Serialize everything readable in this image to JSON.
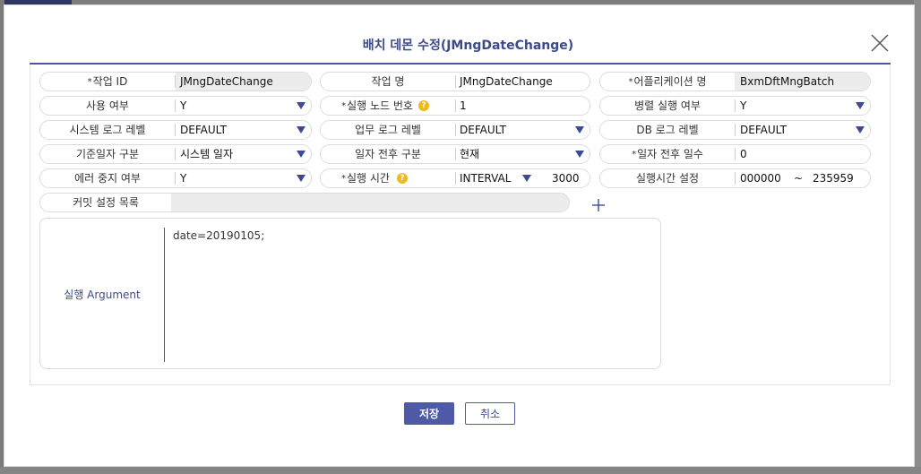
{
  "modal": {
    "title": "배치 데몬 수정(JMngDateChange)",
    "save_label": "저장",
    "cancel_label": "취소"
  },
  "fields": {
    "job_id": {
      "label": "작업 ID",
      "value": "JMngDateChange"
    },
    "job_name": {
      "label": "작업 명",
      "value": "JMngDateChange"
    },
    "app_name": {
      "label": "어플리케이션 명",
      "value": "BxmDftMngBatch"
    },
    "use_yn": {
      "label": "사용 여부",
      "value": "Y"
    },
    "exec_node": {
      "label": "실행 노드 번호",
      "value": "1"
    },
    "parallel_exec": {
      "label": "병렬 실행 여부",
      "value": "Y"
    },
    "sys_log_level": {
      "label": "시스템 로그 레벨",
      "value": "DEFAULT"
    },
    "biz_log_level": {
      "label": "업무 로그 레벨",
      "value": "DEFAULT"
    },
    "db_log_level": {
      "label": "DB 로그 레벨",
      "value": "DEFAULT"
    },
    "base_date_type": {
      "label": "기준일자 구분",
      "value": "시스템 일자"
    },
    "date_before_after": {
      "label": "일자 전후 구분",
      "value": "현재"
    },
    "date_offset_days": {
      "label": "일자 전후 일수",
      "value": "0"
    },
    "stop_on_error": {
      "label": "에러 중지 여부",
      "value": "Y"
    },
    "exec_time": {
      "label": "실행 시간",
      "value": "INTERVAL",
      "interval_value": "3000"
    },
    "exec_time_range": {
      "label": "실행시간 설정",
      "start": "000000",
      "tilde": "~",
      "end": "235959"
    },
    "commit_list": {
      "label": "커밋 설정 목록",
      "value": ""
    }
  },
  "argument": {
    "label": "실행 Argument",
    "value": "date=20190105;"
  },
  "required_mark": "*",
  "help_mark": "?",
  "colors": {
    "accent": "#4e5aa6",
    "title": "#3d4a8a",
    "help_icon": "#f0b81c"
  }
}
